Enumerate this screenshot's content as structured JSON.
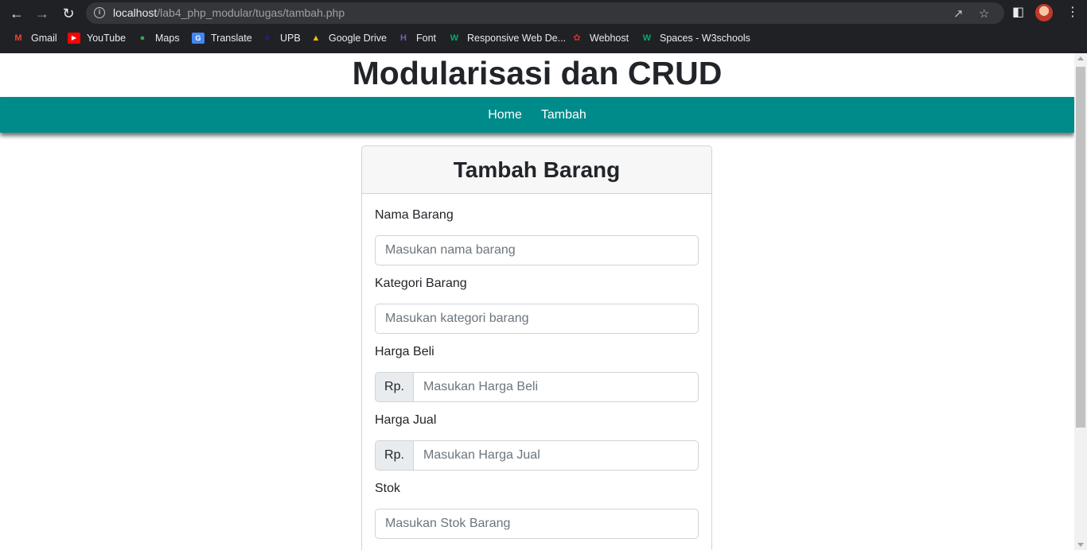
{
  "browser": {
    "url_host": "localhost",
    "url_path": "/lab4_php_modular/tugas/tambah.php",
    "bookmarks": [
      "Gmail",
      "YouTube",
      "Maps",
      "Translate",
      "UPB",
      "Google Drive",
      "Font",
      "Responsive Web De...",
      "Webhost",
      "Spaces - W3schools"
    ]
  },
  "page": {
    "title": "Modularisasi dan CRUD",
    "nav": [
      "Home",
      "Tambah"
    ],
    "nav_color": "#008b8b"
  },
  "form": {
    "heading": "Tambah Barang",
    "currency_prefix": "Rp.",
    "fields": [
      {
        "label": "Nama Barang",
        "placeholder": "Masukan nama barang"
      },
      {
        "label": "Kategori Barang",
        "placeholder": "Masukan kategori barang"
      },
      {
        "label": "Harga Beli",
        "placeholder": "Masukan Harga Beli"
      },
      {
        "label": "Harga Jual",
        "placeholder": "Masukan Harga Jual"
      },
      {
        "label": "Stok",
        "placeholder": "Masukan Stok Barang"
      }
    ]
  }
}
